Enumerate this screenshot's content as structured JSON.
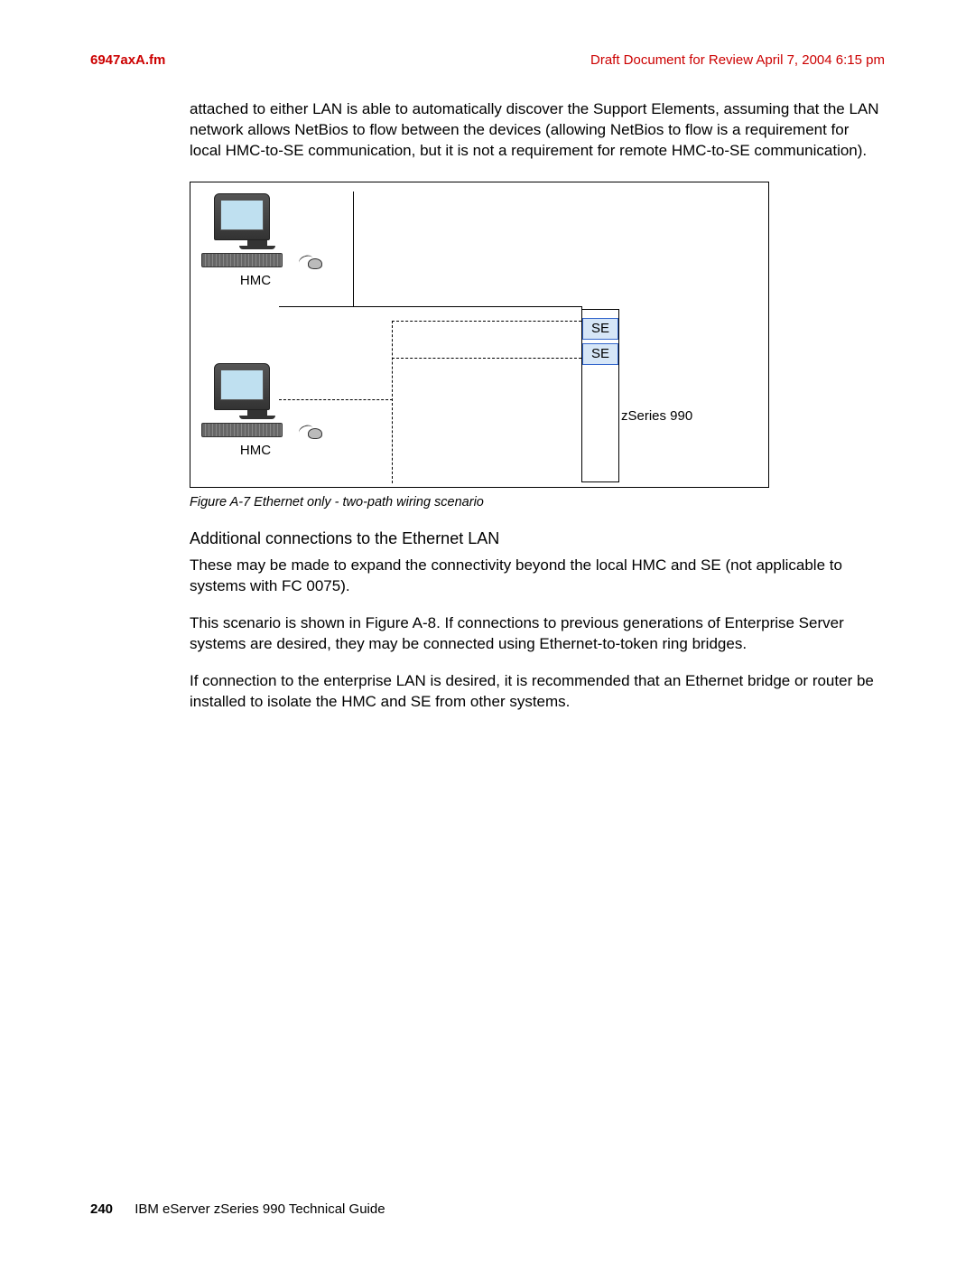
{
  "header": {
    "left": "6947axA.fm",
    "right": "Draft Document for Review April 7, 2004 6:15 pm"
  },
  "body": {
    "intro": "attached to either LAN is able to automatically discover the Support Elements, assuming that the LAN network allows NetBios to flow between the devices (allowing NetBios to flow is a requirement for local HMC-to-SE communication, but it is not a requirement for remote HMC-to-SE communication).",
    "caption": "Figure A-7   Ethernet only - two-path wiring scenario",
    "subhead": "Additional connections to the Ethernet LAN",
    "p1": "These may be made to expand the connectivity beyond the local HMC and SE (not applicable to systems with FC 0075).",
    "p2": "This scenario is shown in Figure A-8. If connections to previous generations of Enterprise Server systems are desired, they may be connected using Ethernet-to-token ring bridges.",
    "p3": "If connection to the enterprise LAN is desired, it is recommended that an Ethernet bridge or router be installed to isolate the HMC and SE from other systems."
  },
  "diagram": {
    "hmc_label": "HMC",
    "se_label": "SE",
    "zseries_label": "zSeries 990"
  },
  "footer": {
    "page": "240",
    "title": "IBM eServer zSeries 990 Technical Guide"
  }
}
